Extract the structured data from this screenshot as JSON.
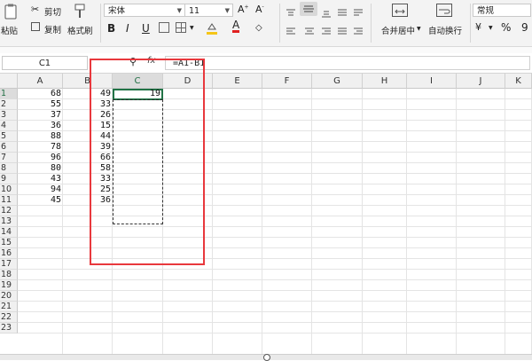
{
  "ribbon": {
    "paste_label": "粘贴",
    "cut_label": "剪切",
    "copy_label": "复制",
    "format_painter_label": "格式刷",
    "font_name": "宋体",
    "font_size": "11",
    "bold": "B",
    "italic": "I",
    "underline": "U",
    "merge_center_label": "合并居中",
    "wrap_text_label": "自动换行",
    "number_format": "常规",
    "percent": "%",
    "thousands": "9"
  },
  "formula_bar": {
    "name_box": "C1",
    "fx_label": "fx",
    "formula": "=A1-B1"
  },
  "sheet": {
    "columns": [
      "A",
      "B",
      "C",
      "D",
      "E",
      "F",
      "G",
      "H",
      "I",
      "J",
      "K"
    ],
    "rows": [
      "1",
      "2",
      "3",
      "4",
      "5",
      "6",
      "7",
      "8",
      "9",
      "10",
      "11",
      "12",
      "13",
      "14",
      "15",
      "16",
      "17",
      "18",
      "19",
      "20",
      "21",
      "22",
      "23"
    ],
    "col_a": [
      "68",
      "55",
      "37",
      "36",
      "88",
      "78",
      "96",
      "80",
      "43",
      "94",
      "45"
    ],
    "col_b": [
      "49",
      "33",
      "26",
      "15",
      "44",
      "39",
      "66",
      "58",
      "33",
      "25",
      "36"
    ],
    "c1_value": "19"
  }
}
